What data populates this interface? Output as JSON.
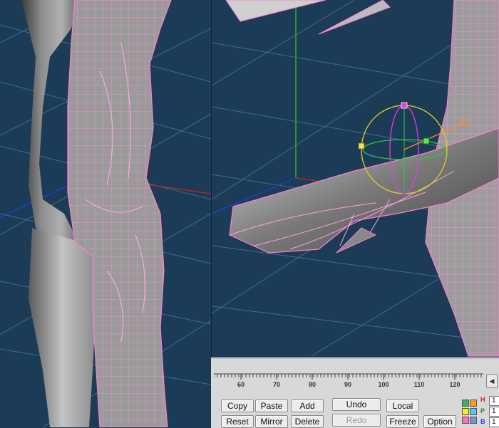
{
  "timeline": {
    "ticks": [
      "60",
      "70",
      "80",
      "90",
      "100",
      "110",
      "120"
    ],
    "scroll_icon": "chevron-left-icon"
  },
  "buttons": {
    "copy": "Copy",
    "paste": "Paste",
    "add": "Add",
    "undo": "Undo",
    "local": "Local",
    "reset": "Reset",
    "mirror": "Mirror",
    "delete": "Delete",
    "redo": "Redo",
    "freeze": "Freeze",
    "option": "Option"
  },
  "hpb": {
    "h": "H",
    "p": "P",
    "b": "B"
  },
  "hpb_values": {
    "h": "1",
    "p": "1",
    "b": "1"
  },
  "colors": {
    "viewport_bg": "#1c3b56",
    "wireframe": "#ff7fd0",
    "axis_x": "#d02020",
    "axis_y": "#20c040",
    "axis_z": "#2040d0",
    "swatches": [
      "#40b060",
      "#ff9a20",
      "#f0f020",
      "#60c0f0",
      "#ff70c0",
      "#8090d0"
    ]
  }
}
